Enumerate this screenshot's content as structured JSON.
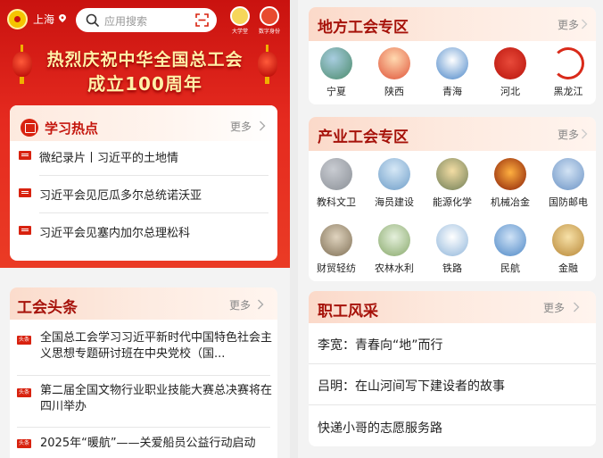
{
  "header": {
    "city": "上海",
    "search_placeholder": "应用搜索",
    "btn_1_label": "大学堂",
    "btn_2_label": "数字身份"
  },
  "banner": {
    "line1": "热烈庆祝中华全国总工会",
    "line2": "成立100周年"
  },
  "study_hot": {
    "title": "学习热点",
    "more": "更多",
    "items": [
      {
        "text": "微纪录片丨习近平的土地情"
      },
      {
        "text": "习近平会见厄瓜多尔总统诺沃亚"
      },
      {
        "text": "习近平会见塞内加尔总理松科"
      }
    ]
  },
  "union_headlines": {
    "title": "工会头条",
    "more": "更多",
    "items": [
      {
        "text": "全国总工会学习习近平新时代中国特色社会主义思想专题研讨班在中央党校（国..."
      },
      {
        "text": "第二届全国文物行业职业技能大赛总决赛将在四川举办"
      },
      {
        "text": "2025年“暖航”——关爱船员公益行动启动"
      }
    ]
  },
  "local_unions": {
    "title": "地方工会专区",
    "more": "更多",
    "items": [
      {
        "label": "宁夏",
        "icon": "ningxia-icon",
        "color": "#4a8a6a"
      },
      {
        "label": "陕西",
        "icon": "shaanxi-icon",
        "color": "#e0553a"
      },
      {
        "label": "青海",
        "icon": "qinghai-icon",
        "color": "#4a86c8"
      },
      {
        "label": "河北",
        "icon": "hebei-icon",
        "color": "#b8130b"
      },
      {
        "label": "黑龙江",
        "icon": "heilongjiang-icon",
        "color": "#d92a1a"
      }
    ]
  },
  "industry_unions": {
    "title": "产业工会专区",
    "more": "更多",
    "items": [
      {
        "label": "教科文卫",
        "icon": "education-icon",
        "color": "#8a8f96"
      },
      {
        "label": "海员建设",
        "icon": "seaman-icon",
        "color": "#6f9ec9"
      },
      {
        "label": "能源化学",
        "icon": "energy-icon",
        "color": "#d5a95a"
      },
      {
        "label": "机械冶金",
        "icon": "metallurgy-icon",
        "color": "#d24a12"
      },
      {
        "label": "国防邮电",
        "icon": "post-icon",
        "color": "#6b93c5"
      },
      {
        "label": "财贸轻纺",
        "icon": "trade-icon",
        "color": "#9c8b70"
      },
      {
        "label": "农林水利",
        "icon": "agriculture-icon",
        "color": "#87a86a"
      },
      {
        "label": "铁路",
        "icon": "railway-icon",
        "color": "#8fb5da"
      },
      {
        "label": "民航",
        "icon": "aviation-icon",
        "color": "#4e88c6"
      },
      {
        "label": "金融",
        "icon": "finance-icon",
        "color": "#d3a55a"
      }
    ]
  },
  "worker_style": {
    "title": "职工风采",
    "more": "更多",
    "items": [
      {
        "text": "李宽：青春向“地”而行"
      },
      {
        "text": "吕明：在山河间写下建设者的故事"
      },
      {
        "text": "快递小哥的志愿服务路"
      }
    ]
  },
  "colors": {
    "brand_red": "#d8220f",
    "title_red": "#a6120a",
    "banner_yellow": "#fff1a8"
  }
}
